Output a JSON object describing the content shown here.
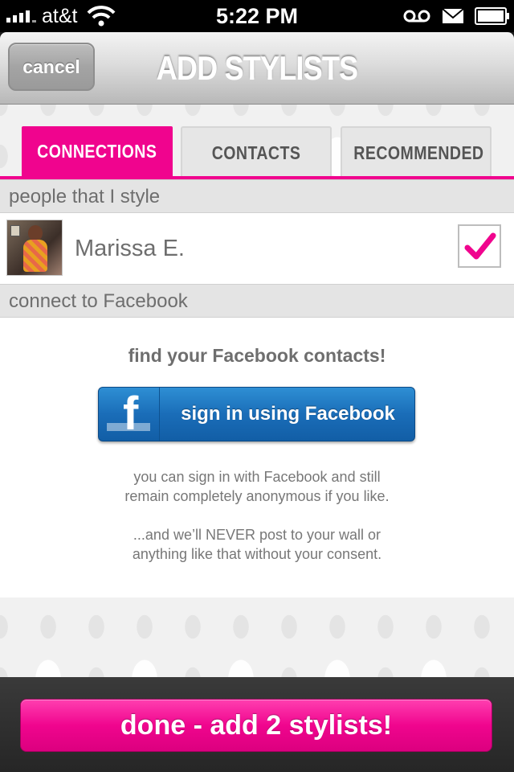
{
  "status_bar": {
    "carrier": "at&t",
    "time": "5:22 PM",
    "icons": [
      "signal-icon",
      "wifi-icon",
      "voicemail-icon",
      "mail-icon",
      "battery-icon"
    ]
  },
  "nav": {
    "cancel_label": "cancel",
    "title": "ADD STYLISTS"
  },
  "tabs": [
    {
      "label": "CONNECTIONS",
      "active": true
    },
    {
      "label": "CONTACTS",
      "active": false
    },
    {
      "label": "RECOMMENDED",
      "active": false
    }
  ],
  "sections": {
    "people_header": "people that I style",
    "facebook_header": "connect to Facebook"
  },
  "people": [
    {
      "name": "Marissa E.",
      "checked": true
    }
  ],
  "facebook": {
    "title": "find your Facebook contacts!",
    "button_label": "sign in using Facebook",
    "logo_letter": "f",
    "note_1_line_1": "you can sign in with Facebook and still",
    "note_1_line_2": "remain completely anonymous if you like.",
    "note_2_line_1": "...and we’ll NEVER post to your wall or",
    "note_2_line_2": "anything like that without your consent."
  },
  "footer": {
    "done_label": "done - add 2 stylists!"
  },
  "colors": {
    "accent_pink": "#f0048e",
    "facebook_blue": "#1a6db8",
    "text_gray": "#6e6e6e"
  }
}
